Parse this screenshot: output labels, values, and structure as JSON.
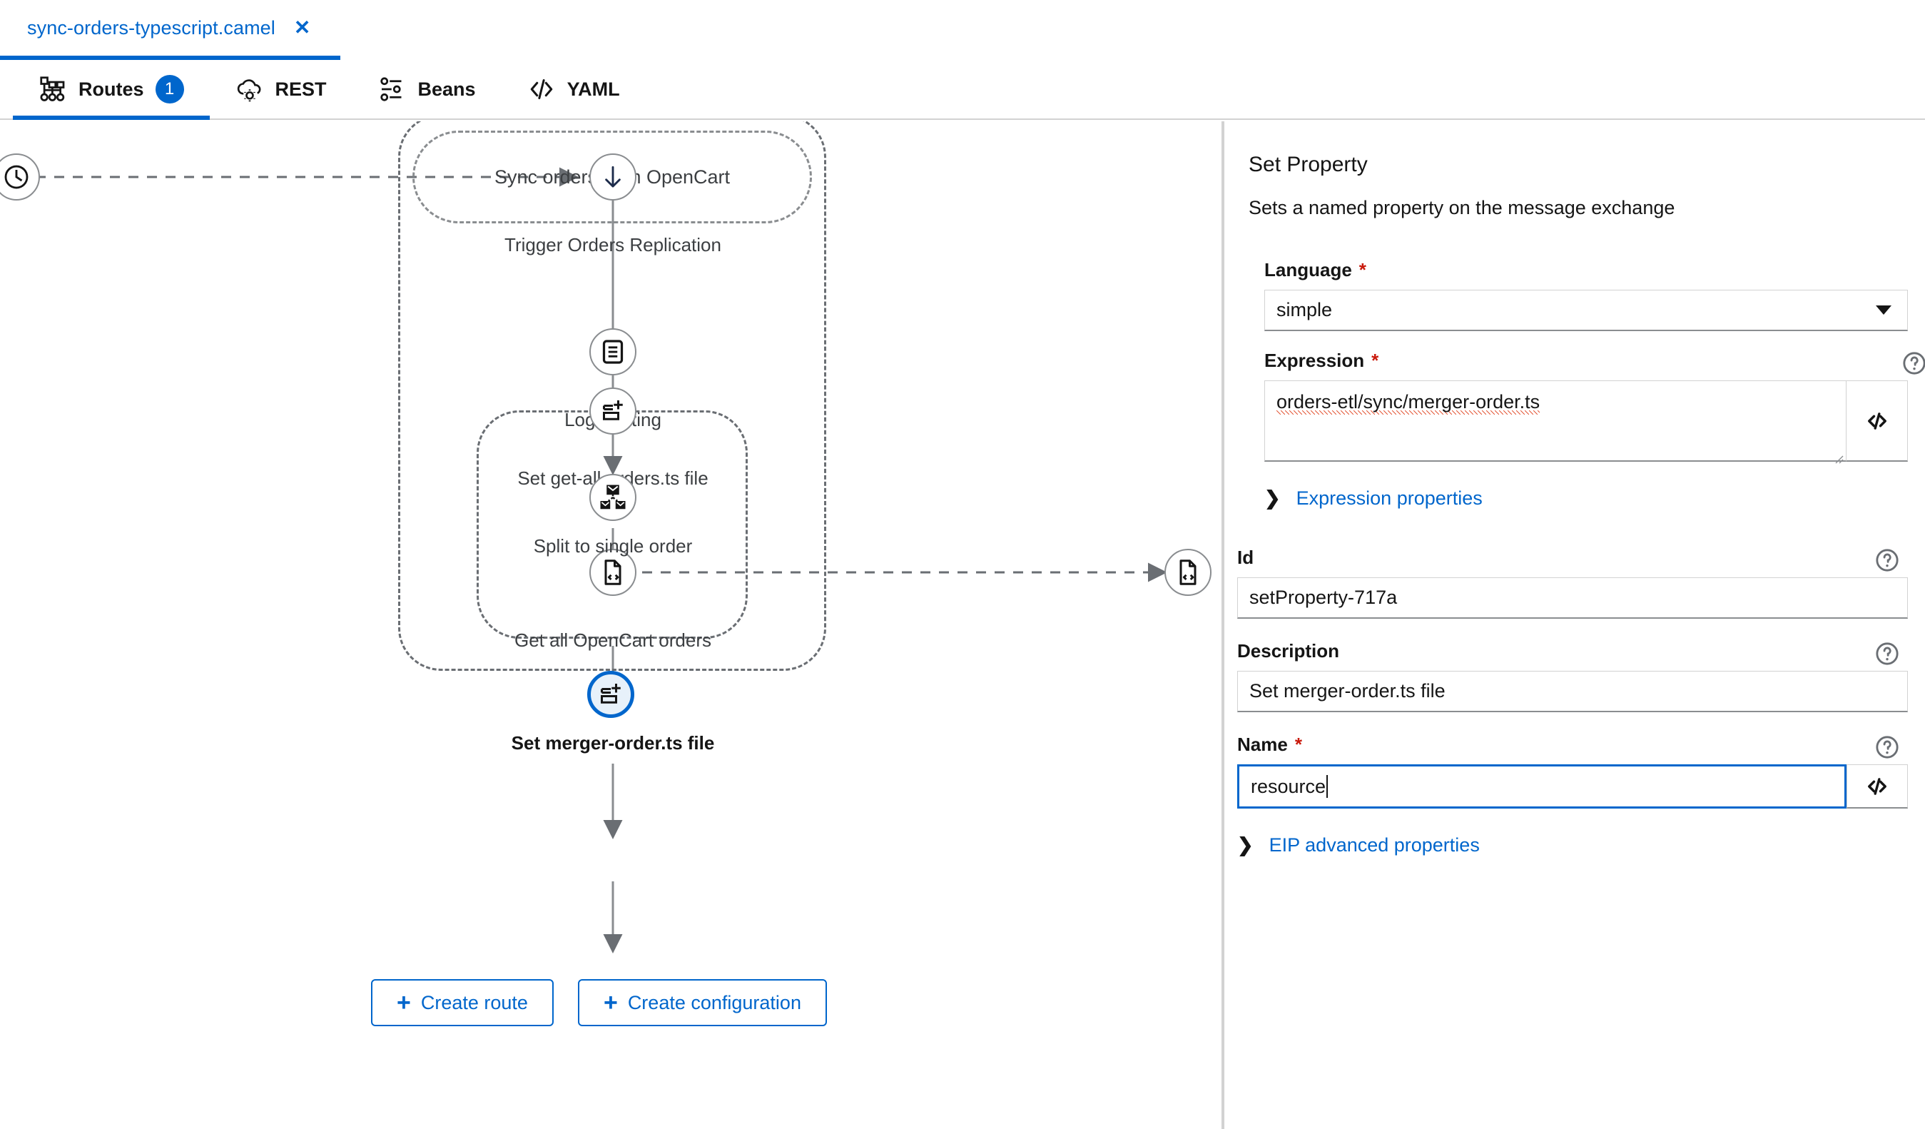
{
  "file_tabs": [
    {
      "label": "sync-orders-typescript.camel",
      "close_icon": "close-icon",
      "active": true
    }
  ],
  "nav_tabs": [
    {
      "label": "Routes",
      "icon": "routes-icon",
      "badge": "1",
      "active": true
    },
    {
      "label": "REST",
      "icon": "rest-cloud-icon",
      "badge": null,
      "active": false
    },
    {
      "label": "Beans",
      "icon": "beans-sliders-icon",
      "badge": null,
      "active": false
    },
    {
      "label": "YAML",
      "icon": "code-yaml-icon",
      "badge": null,
      "active": false
    }
  ],
  "canvas": {
    "route_title": "Sync orders from OpenCart",
    "source_node": {
      "icon": "timer-clock-icon",
      "label": ""
    },
    "external_node": {
      "icon": "file-code-icon",
      "label": ""
    },
    "nodes": [
      {
        "icon": "arrow-down-icon",
        "label": "Trigger Orders Replication",
        "selected": false
      },
      {
        "icon": "log-document-icon",
        "label": "Log starting",
        "selected": false
      },
      {
        "icon": "set-property-icon",
        "label": "Set get-all-orders.ts file",
        "selected": false
      },
      {
        "icon": "file-code-icon",
        "label": "Get all OpenCart orders",
        "selected": false
      },
      {
        "icon": "split-envelopes-icon",
        "label": "Split to single order",
        "selected": false
      },
      {
        "icon": "set-property-icon",
        "label": "Set merger-order.ts file",
        "selected": true
      }
    ],
    "actions": [
      {
        "label": "Create route",
        "icon": "plus-icon"
      },
      {
        "label": "Create configuration",
        "icon": "plus-icon"
      }
    ]
  },
  "panel": {
    "title": "Set Property",
    "description": "Sets a named property on the message exchange",
    "fields": {
      "language": {
        "label": "Language",
        "required": "*",
        "value": "simple",
        "control": "select",
        "caret_icon": "chevron-down-icon"
      },
      "expression": {
        "label": "Expression",
        "required": "*",
        "value": "orders-etl/sync/merger-order.ts",
        "help_icon": "help-circle-icon",
        "code_icon": "code-brackets-icon"
      },
      "id": {
        "label": "Id",
        "value": "setProperty-717a",
        "help_icon": "help-circle-icon"
      },
      "description": {
        "label": "Description",
        "value": "Set merger-order.ts file",
        "help_icon": "help-circle-icon"
      },
      "name": {
        "label": "Name",
        "required": "*",
        "value": "resource",
        "focused": true,
        "help_icon": "help-circle-icon",
        "code_icon": "code-brackets-icon"
      }
    },
    "expanders": [
      {
        "label": "Expression properties",
        "chevron_icon": "chevron-right-icon"
      },
      {
        "label": "EIP advanced properties",
        "chevron_icon": "chevron-right-icon"
      }
    ]
  },
  "colors": {
    "accent": "#0066cc",
    "required": "#c9190b",
    "text": "#151515",
    "muted": "#3c3f42",
    "border": "#d2d2d2",
    "node_stroke": "#8a8d90",
    "selected_fill": "#e7f1fa"
  }
}
